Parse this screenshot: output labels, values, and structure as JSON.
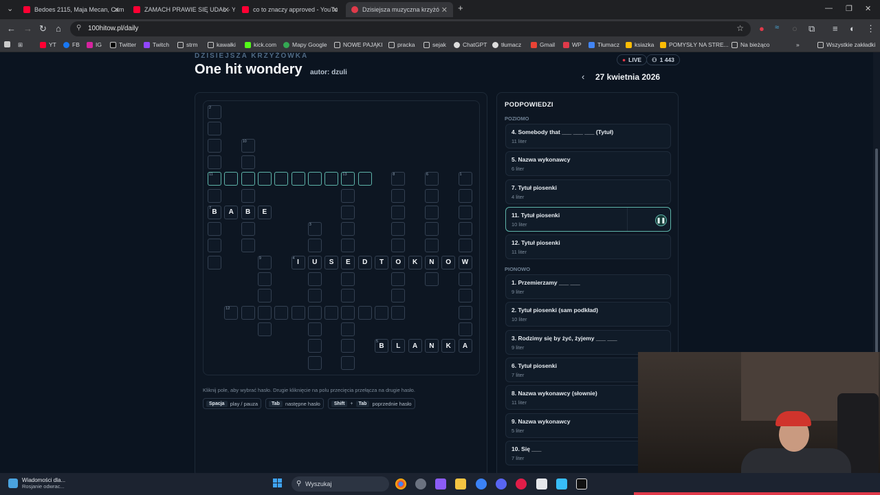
{
  "browser": {
    "tabs": [
      {
        "label": "Bedoes 2115, Maja Mecan, Cam",
        "color": "#ff0033"
      },
      {
        "label": "ZAMACH PRAWIE SIĘ UDAŁ - Yo",
        "color": "#ff0033"
      },
      {
        "label": "co to znaczy approved - YouTu",
        "color": "#ff0033"
      },
      {
        "label": "Dzisiejsza muzyczna krzyżó",
        "color": "#e03a4a"
      }
    ],
    "url": "100hitow.pl/daily",
    "bookmarks": [
      "YT",
      "FB",
      "IG",
      "Twitter",
      "Twitch",
      "strm",
      "kawałki",
      "kick.com",
      "Mapy Google",
      "NOWE PAJĄKI",
      "pracka",
      "sejak",
      "ChatGPT",
      "tłumacz",
      "Gmail",
      "WP",
      "Tłumacz",
      "ksiazka",
      "POMYSŁY NA STRE...",
      "Na bieżąco",
      "Wszystkie zakładki"
    ]
  },
  "header": {
    "kicker": "DZISIEJSZA KRZYŻÓWKA",
    "title": "One hit wondery",
    "author": "autor: dzuli",
    "live": "LIVE",
    "count": "1 443",
    "date": "27 kwietnia 2026"
  },
  "crossword": {
    "hint": "Kliknij pole, aby wybrać hasło. Drugie kliknięcie na polu przecięcia przełącza na drugie hasło.",
    "keys": [
      {
        "keys": [
          "Spacja"
        ],
        "label": "play / pauza"
      },
      {
        "keys": [
          "Tab"
        ],
        "label": "następne hasło"
      },
      {
        "keys": [
          "Shift",
          "Tab"
        ],
        "label": "poprzednie hasło"
      }
    ],
    "babe": "BABE",
    "iusedtoknow": "IUSEDTOKNOW",
    "blanka": "BLANKA"
  },
  "clues": {
    "title": "PODPOWIEDZI",
    "across_label": "POZIOMO",
    "down_label": "PIONOWO",
    "across": [
      {
        "title": "4. Somebody that ___ ___ ___ (Tytuł)",
        "len": "11 liter"
      },
      {
        "title": "5. Nazwa wykonawcy",
        "len": "6 liter"
      },
      {
        "title": "7. Tytuł piosenki",
        "len": "4 liter"
      },
      {
        "title": "11. Tytuł piosenki",
        "len": "10 liter"
      },
      {
        "title": "12. Tytuł piosenki",
        "len": "11 liter"
      }
    ],
    "down": [
      {
        "title": "1. Przemierzamy ___ ___",
        "len": "9 liter"
      },
      {
        "title": "2. Tytuł piosenki (sam podkład)",
        "len": "10 liter"
      },
      {
        "title": "3. Rodzimy się by żyć, żyjemy ___ ___",
        "len": "9 liter"
      },
      {
        "title": "6. Tytuł piosenki",
        "len": "7 liter"
      },
      {
        "title": "8. Nazwa wykonawcy (słownie)",
        "len": "11 liter"
      },
      {
        "title": "9. Nazwa wykonawcy",
        "len": "5 liter"
      },
      {
        "title": "10. Się ___",
        "len": "7 liter"
      }
    ],
    "play_icon": "pause-icon"
  },
  "taskbar": {
    "notif_title": "Wiadomości dla...",
    "notif_sub": "Rosjanie odwrac...",
    "search": "Wyszukaj"
  },
  "colors": {
    "accent": "#5eb4aa",
    "bg": "#0b1420"
  }
}
